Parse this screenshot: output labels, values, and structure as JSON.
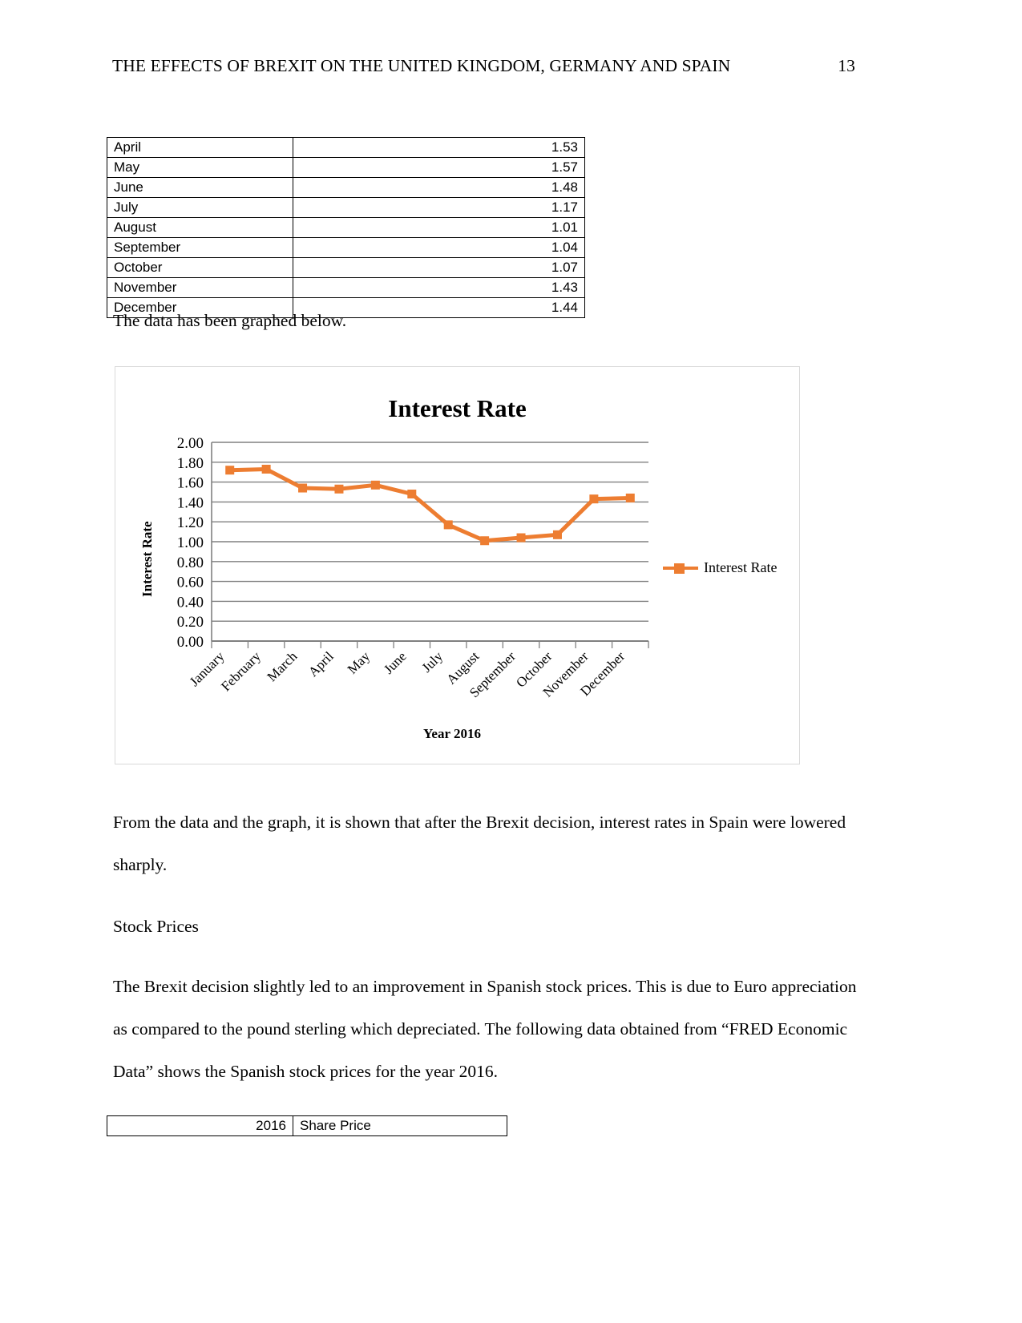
{
  "header": {
    "title": "THE EFFECTS OF BREXIT ON THE UNITED KINGDOM, GERMANY AND SPAIN",
    "page_number": "13"
  },
  "interest_table": {
    "rows": [
      {
        "month": "April",
        "value": "1.53"
      },
      {
        "month": "May",
        "value": "1.57"
      },
      {
        "month": "June",
        "value": "1.48"
      },
      {
        "month": "July",
        "value": "1.17"
      },
      {
        "month": "August",
        "value": "1.01"
      },
      {
        "month": "September",
        "value": "1.04"
      },
      {
        "month": "October",
        "value": "1.07"
      },
      {
        "month": "November",
        "value": "1.43"
      },
      {
        "month": "December",
        "value": "1.44"
      }
    ]
  },
  "caption": "The data has been graphed below.",
  "chart_data": {
    "type": "line",
    "title": "Interest Rate",
    "xlabel": "Year 2016",
    "ylabel": "Interest Rate",
    "ylim": [
      0.0,
      2.0
    ],
    "ytick_labels": [
      "2.00",
      "1.80",
      "1.60",
      "1.40",
      "1.20",
      "1.00",
      "0.80",
      "0.60",
      "0.40",
      "0.20",
      "0.00"
    ],
    "ytick_values": [
      2.0,
      1.8,
      1.6,
      1.4,
      1.2,
      1.0,
      0.8,
      0.6,
      0.4,
      0.2,
      0.0
    ],
    "grid": true,
    "legend_position": "right",
    "series_color": "#ED7D31",
    "marker": "square",
    "categories": [
      "January",
      "February",
      "March",
      "April",
      "May",
      "June",
      "July",
      "August",
      "September",
      "October",
      "November",
      "December"
    ],
    "series": [
      {
        "name": "Interest Rate",
        "values": [
          1.72,
          1.73,
          1.54,
          1.53,
          1.57,
          1.48,
          1.17,
          1.01,
          1.04,
          1.07,
          1.43,
          1.44
        ]
      }
    ]
  },
  "paragraphs": {
    "p1": "From the data and the graph, it is shown that after the Brexit decision, interest rates in Spain were lowered sharply.",
    "p2": "Stock Prices",
    "p3": "The Brexit decision slightly led to an improvement in Spanish stock prices. This is due to Euro appreciation as compared to the pound sterling which depreciated. The following data obtained from “FRED Economic Data” shows the Spanish stock prices for the year 2016."
  },
  "stock_table": {
    "year_label": "2016",
    "column_header": "Share Price"
  }
}
